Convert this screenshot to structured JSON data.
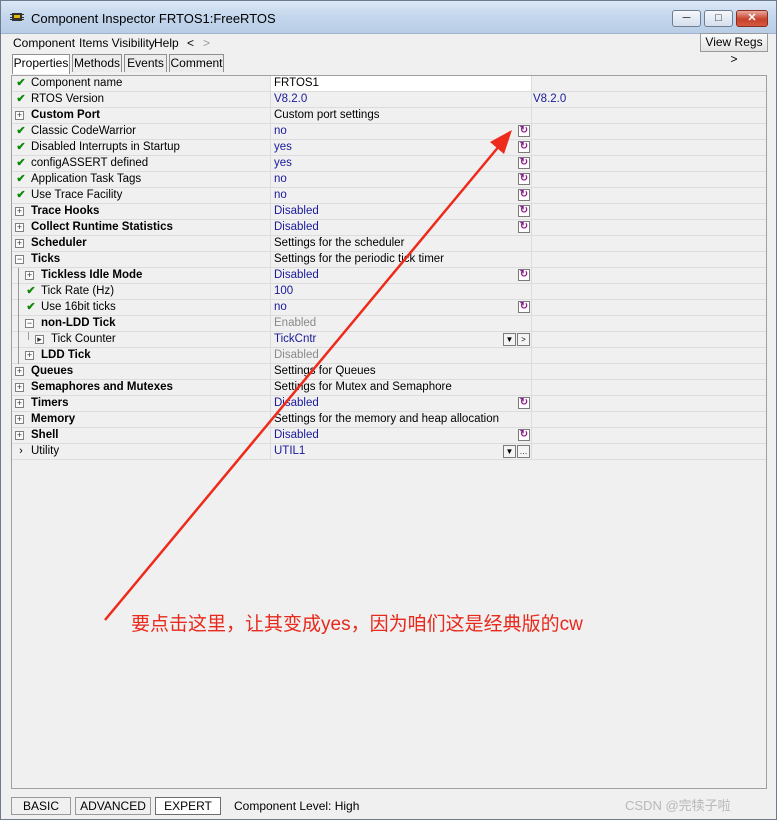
{
  "window": {
    "title": "Component Inspector FRTOS1:FreeRTOS",
    "buttons": {
      "minimize": "─",
      "maximize": "□",
      "close": "✕"
    }
  },
  "menubar": {
    "items": [
      "Component",
      "Items Visibility",
      "Help",
      "<",
      ">"
    ],
    "view_regs": "View Regs >"
  },
  "tabs": [
    "Properties",
    "Methods",
    "Events",
    "Comment"
  ],
  "grid": {
    "rows": [
      {
        "icon": "check",
        "name": "Component name",
        "value": "FRTOS1"
      },
      {
        "icon": "check",
        "name": "RTOS Version",
        "value": "V8.2.0",
        "value2": "V8.2.0"
      },
      {
        "icon": "expand",
        "name": "Custom Port",
        "value": "Custom port settings"
      },
      {
        "icon": "check",
        "name": "Classic CodeWarrior",
        "value": "no"
      },
      {
        "icon": "check",
        "name": "Disabled Interrupts in Startup",
        "value": "yes"
      },
      {
        "icon": "check",
        "name": "configASSERT defined",
        "value": "yes"
      },
      {
        "icon": "check",
        "name": "Application Task Tags",
        "value": "no"
      },
      {
        "icon": "check",
        "name": "Use Trace Facility",
        "value": "no"
      },
      {
        "icon": "expand",
        "name": "Trace Hooks",
        "value": "Disabled"
      },
      {
        "icon": "expand",
        "name": "Collect Runtime Statistics",
        "value": "Disabled"
      },
      {
        "icon": "expand",
        "name": "Scheduler",
        "value": "Settings for the scheduler"
      },
      {
        "icon": "collapse",
        "name": "Ticks",
        "value": "Settings for the periodic tick timer"
      },
      {
        "icon": "expand",
        "name": "Tickless Idle Mode",
        "value": "Disabled"
      },
      {
        "icon": "check",
        "name": "Tick Rate (Hz)",
        "value": "100"
      },
      {
        "icon": "check",
        "name": "Use 16bit ticks",
        "value": "no"
      },
      {
        "icon": "collapse",
        "name": "non-LDD Tick",
        "value": "Enabled"
      },
      {
        "icon": "arrow-box",
        "name": "Tick Counter",
        "value": "TickCntr"
      },
      {
        "icon": "expand",
        "name": "LDD Tick",
        "value": "Disabled"
      },
      {
        "icon": "expand",
        "name": "Queues",
        "value": "Settings for Queues"
      },
      {
        "icon": "expand",
        "name": "Semaphores and Mutexes",
        "value": "Settings for Mutex and Semaphore"
      },
      {
        "icon": "expand",
        "name": "Timers",
        "value": "Disabled"
      },
      {
        "icon": "expand",
        "name": "Memory",
        "value": "Settings for the memory and heap allocation"
      },
      {
        "icon": "expand",
        "name": "Shell",
        "value": "Disabled"
      },
      {
        "icon": "arrow",
        "name": "Utility",
        "value": "UTIL1"
      }
    ]
  },
  "annotation": {
    "text": "要点击这里，让其变成yes，因为咱们这是经典版的cw",
    "color": "#e8291c"
  },
  "statusbar": {
    "levels": [
      "BASIC",
      "ADVANCED",
      "EXPERT"
    ],
    "active": "EXPERT",
    "component_level": "Component Level: High"
  },
  "watermark": "CSDN @完犊子啦"
}
